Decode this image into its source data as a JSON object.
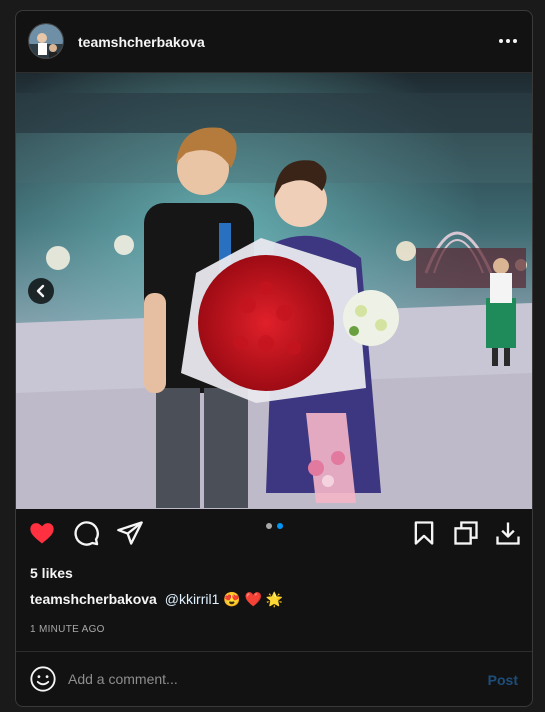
{
  "post": {
    "username": "teamshcherbakova",
    "more_icon": "more-horizontal-icon",
    "likes": "5 likes",
    "caption": {
      "username": "teamshcherbakova",
      "mention": "@kkirril1",
      "emojis": "😍 ❤️ 🌟"
    },
    "timestamp": "1 MINUTE AGO",
    "carousel": {
      "current": 2,
      "total": 2
    }
  },
  "actions": {
    "like_icon": "heart-filled-icon",
    "comment_icon": "comment-icon",
    "share_icon": "send-icon",
    "save_icon": "bookmark-icon",
    "repost_icon": "copy-icon",
    "download_icon": "download-icon"
  },
  "comment": {
    "placeholder": "Add a comment...",
    "post_label": "Post",
    "emoji_icon": "smiley-icon"
  },
  "colors": {
    "like_red": "#ff3040",
    "dot_active": "#0095f6",
    "dot_inactive": "#a8a8a8",
    "post_disabled": "#1d4e7a"
  }
}
